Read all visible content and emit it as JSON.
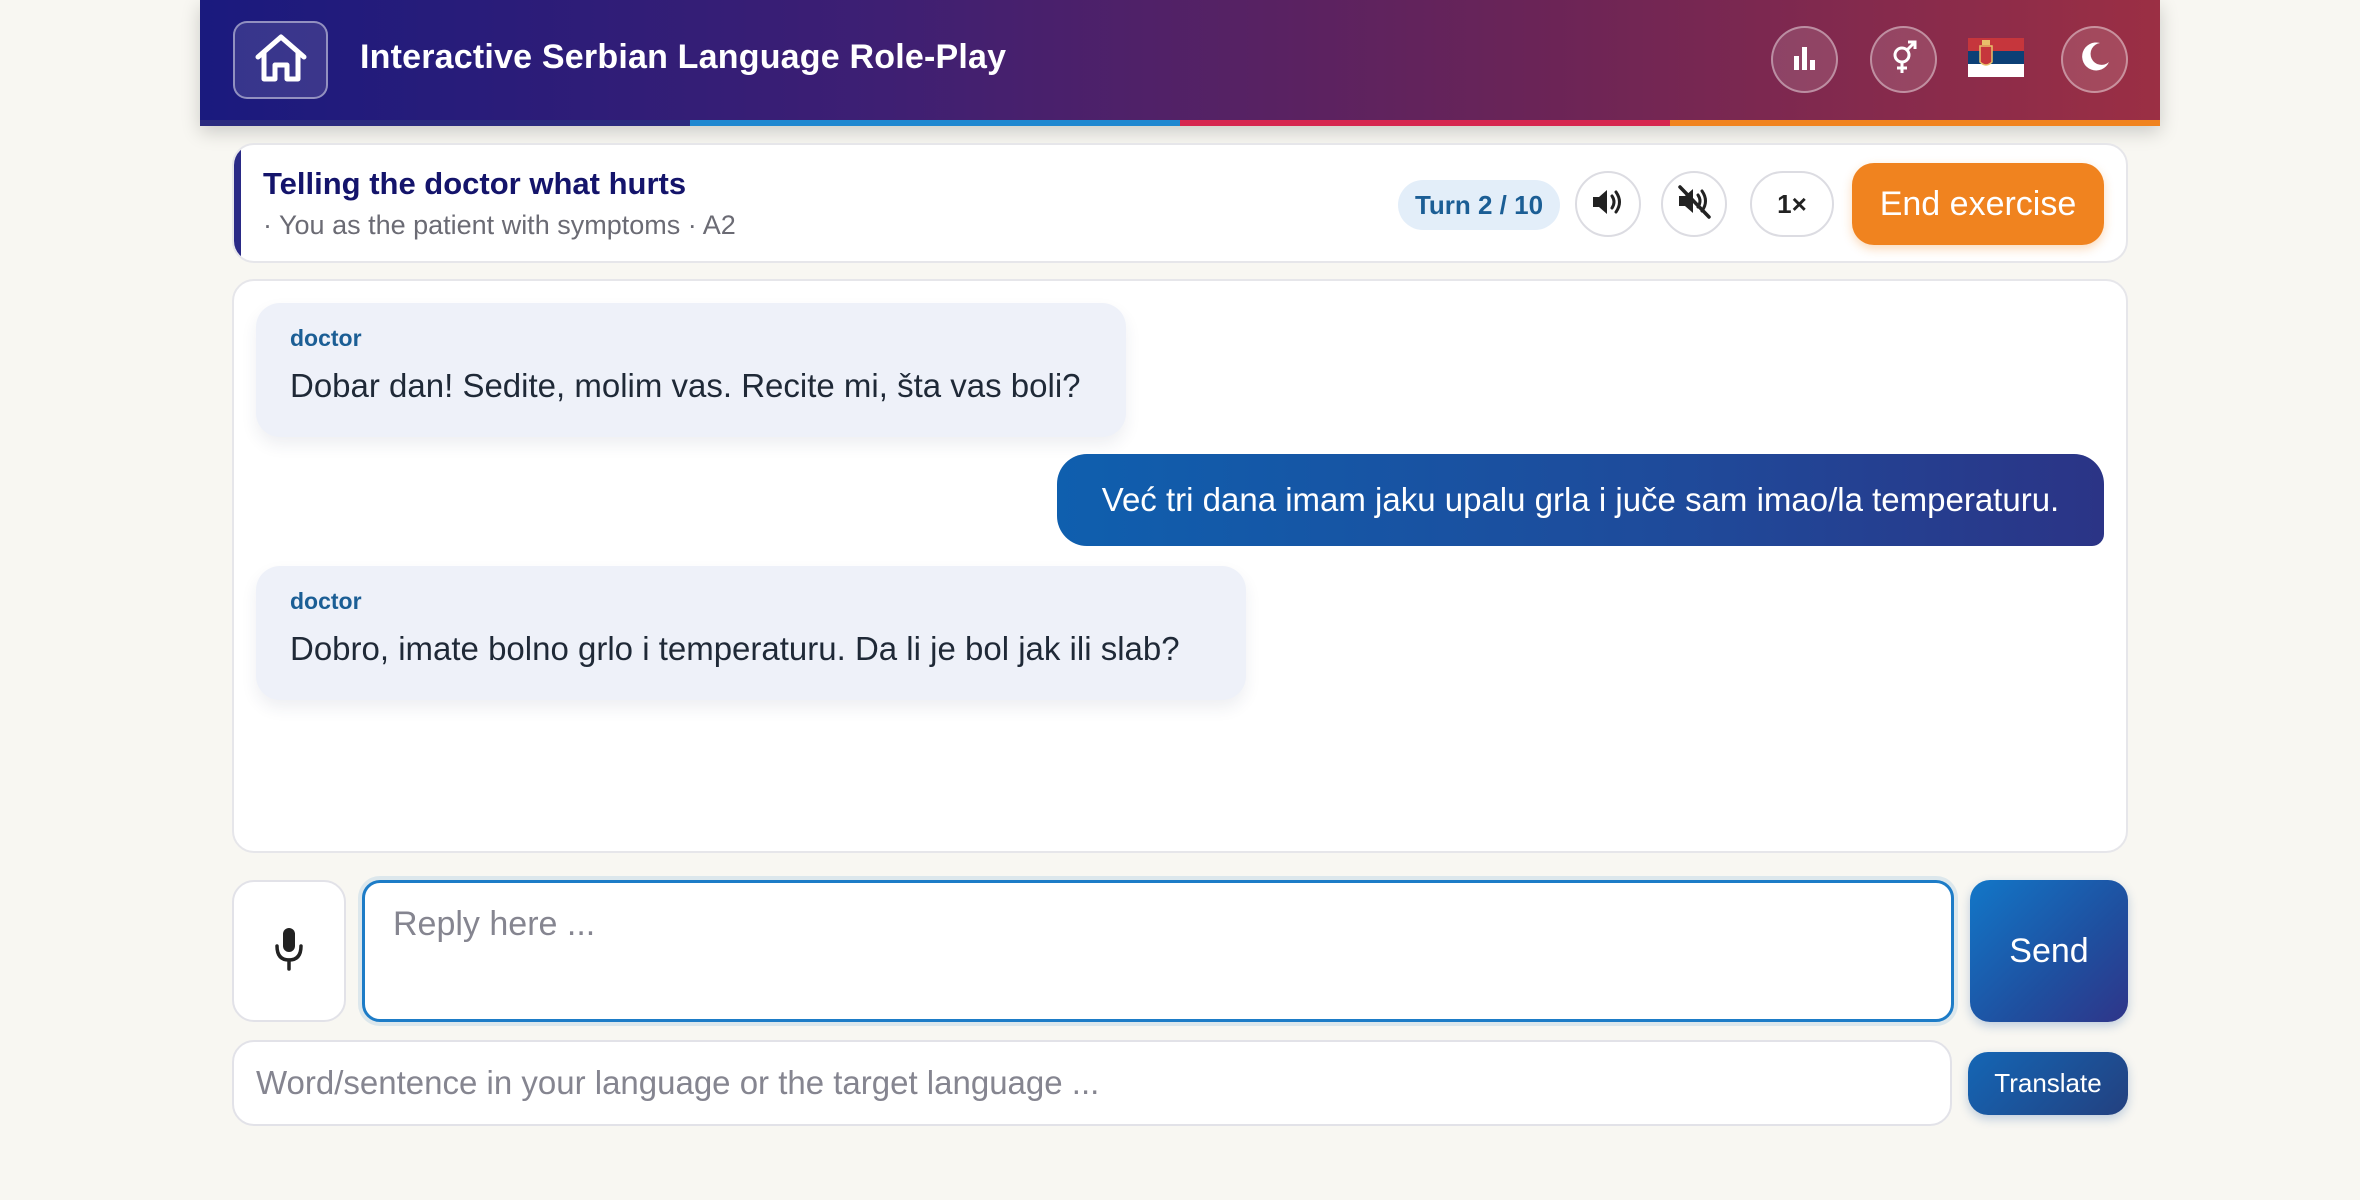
{
  "header": {
    "title": "Interactive Serbian Language Role-Play",
    "icons": [
      "home-icon",
      "stats-icon",
      "gender-icon",
      "serbia-flag-icon",
      "moon-icon"
    ],
    "stripe_colors": [
      "#1a1a7e",
      "#1f88d0",
      "#d6264f",
      "#f0831f"
    ]
  },
  "exercise": {
    "title": "Telling the doctor what hurts",
    "subtitle": "· You as the patient with symptoms · A2",
    "turn": "Turn 2 / 10",
    "speed": "1×",
    "end_label": "End exercise",
    "icons": [
      "speaker-icon",
      "mute-icon"
    ]
  },
  "chat": {
    "messages": [
      {
        "role": "incoming",
        "speaker": "doctor",
        "text": "Dobar dan! Sedite, molim vas. Recite mi, šta vas boli?"
      },
      {
        "role": "outgoing",
        "text": "Već tri dana imam jaku upalu grla i juče sam imao/la temperaturu."
      },
      {
        "role": "incoming",
        "speaker": "doctor",
        "text": "Dobro, imate bolno grlo i temperaturu. Da li je bol jak ili slab?"
      }
    ]
  },
  "composer": {
    "reply_placeholder": "Reply here ...",
    "reply_value": "",
    "send_label": "Send",
    "mic_icon": "microphone-icon"
  },
  "translator": {
    "placeholder": "Word/sentence in your language or the target language ...",
    "value": "",
    "button_label": "Translate"
  },
  "colors": {
    "accent_blue": "#1f88d0",
    "accent_orange": "#f0831f",
    "navy": "#14146b"
  }
}
